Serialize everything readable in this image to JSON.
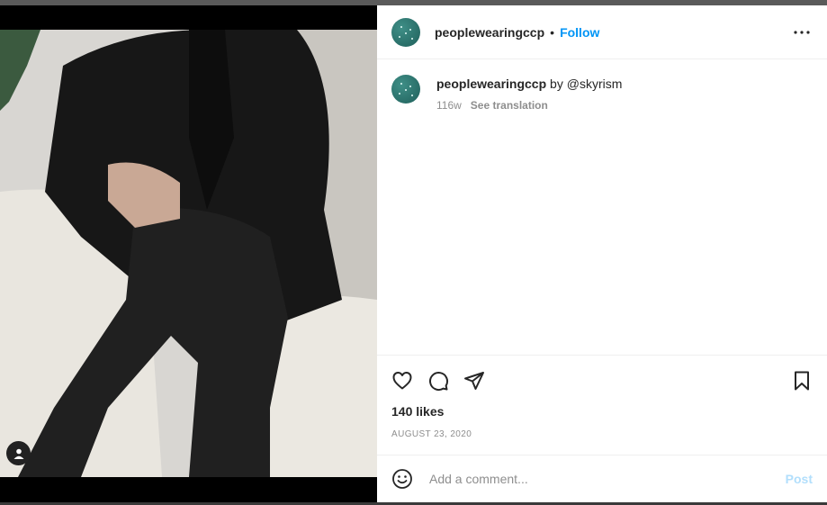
{
  "post": {
    "username": "peoplewearingccp",
    "follow_label": "Follow",
    "separator": "•",
    "caption": {
      "username": "peoplewearingccp",
      "text": "by",
      "mention": "@skyrism",
      "age": "116w",
      "translation_label": "See translation"
    },
    "likes": "140 likes",
    "date": "AUGUST 23, 2020"
  },
  "comment_box": {
    "placeholder": "Add a comment...",
    "post_label": "Post"
  },
  "icons": {
    "more": "more-options-icon",
    "like": "heart-icon",
    "comment": "comment-icon",
    "share": "share-icon",
    "save": "bookmark-icon",
    "emoji": "emoji-icon",
    "user_tag": "user-tag-icon"
  },
  "colors": {
    "accent": "#0095f6",
    "post_disabled": "#b2dffc",
    "muted": "#8e8e8e"
  }
}
